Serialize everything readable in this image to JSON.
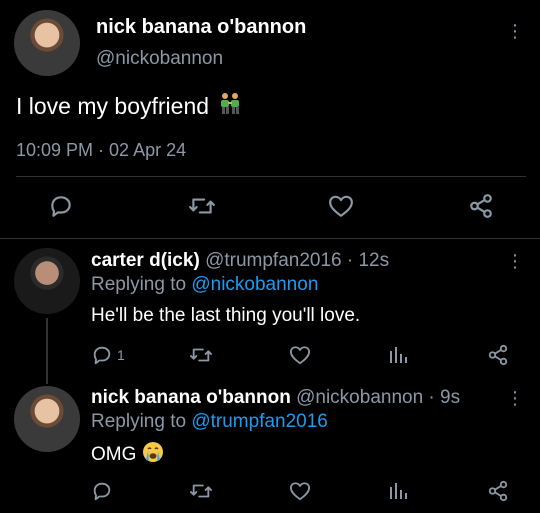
{
  "main_tweet": {
    "display_name": "nick banana o'bannon",
    "handle": "@nickobannon",
    "text": "I love my boyfriend",
    "timestamp": "10:09 PM · 02 Apr 24"
  },
  "replies": [
    {
      "display_name": "carter d(ick)",
      "handle_time": "@trumpfan2016 · 12s",
      "replying_prefix": "Replying to",
      "replying_to": "@nickobannon",
      "text": "He'll be the last thing you'll love.",
      "reply_count": "1"
    },
    {
      "display_name": "nick banana o'bannon",
      "handle_time": "@nickobannon · 9s",
      "replying_prefix": "Replying to",
      "replying_to": "@trumpfan2016",
      "text": "OMG"
    }
  ],
  "icons": {
    "reply": "reply-icon",
    "retweet": "retweet-icon",
    "like": "heart-icon",
    "stats": "stats-icon",
    "share": "share-icon",
    "more": "more-vertical-icon",
    "couple_emoji": "couple-emoji",
    "crying_emoji": "crying-emoji"
  },
  "colors": {
    "background": "#000000",
    "text": "#ffffff",
    "muted": "#8b98a5",
    "link": "#1d9bf0",
    "divider": "#2f3336"
  }
}
